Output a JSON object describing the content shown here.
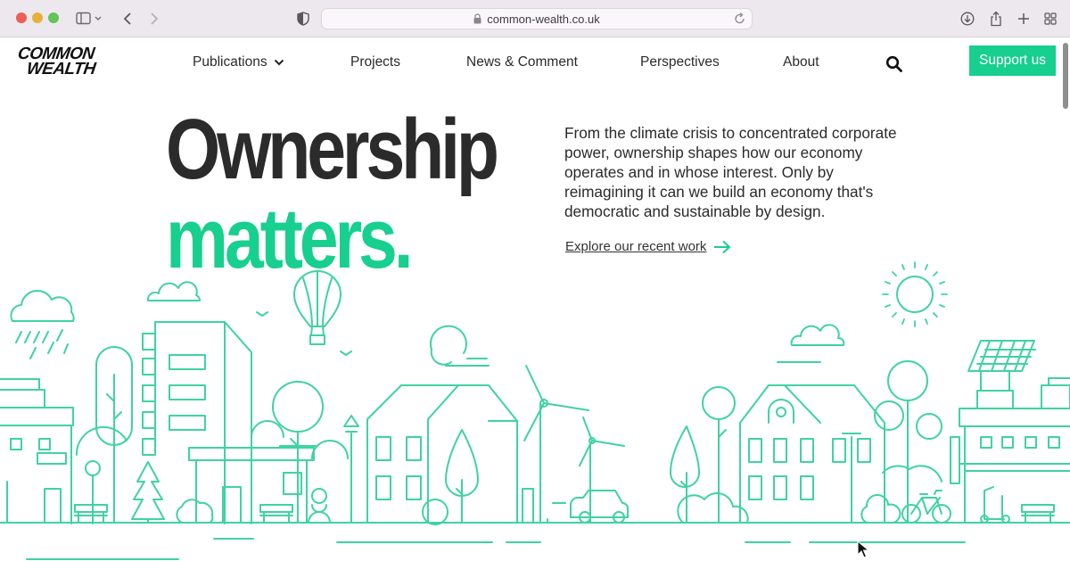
{
  "browser": {
    "url": "common-wealth.co.uk"
  },
  "site": {
    "logo_lines": [
      "COMMON",
      "WEALTH"
    ],
    "nav": {
      "publications": "Publications",
      "projects": "Projects",
      "news": "News & Comment",
      "perspectives": "Perspectives",
      "about": "About"
    },
    "support_label": "Support us"
  },
  "hero": {
    "title_line1": "Ownership",
    "title_line2": "matters.",
    "description": "From the climate crisis to concentrated corporate power, ownership shapes how our economy operates and in whose interest. Only by reimagining it can we build an economy that's democratic and sustainable by design.",
    "explore_label": "Explore our recent work"
  },
  "colors": {
    "accent": "#17cf8e",
    "text": "#2b2b2b",
    "line_art": "#3fd3a0"
  },
  "icons": [
    "sidebar-icon",
    "chevron-down-icon",
    "back-arrow-icon",
    "forward-arrow-icon",
    "shield-icon",
    "lock-icon",
    "reload-icon",
    "download-icon",
    "share-icon",
    "plus-icon",
    "tab-grid-icon",
    "search-icon",
    "arrow-right-icon"
  ]
}
